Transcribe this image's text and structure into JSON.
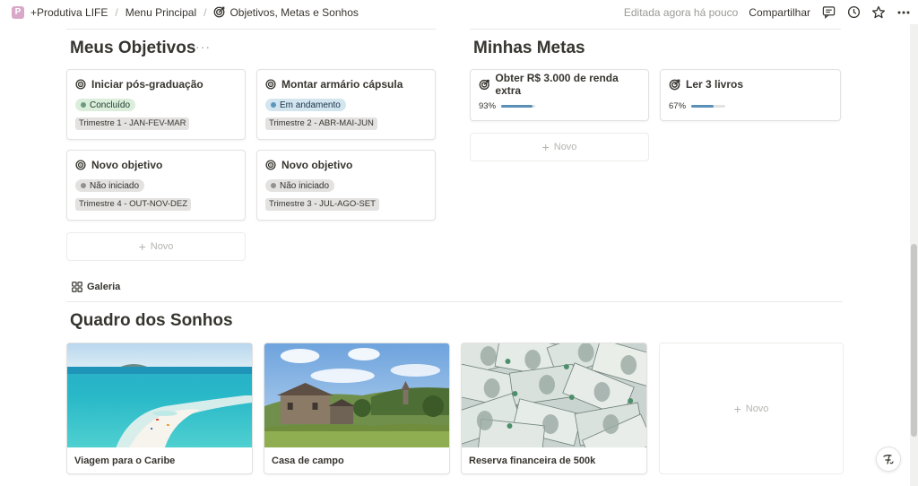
{
  "breadcrumb": {
    "workspace": "+Produtiva LIFE",
    "parent": "Menu Principal",
    "current": "Objetivos, Metas e Sonhos"
  },
  "topbar": {
    "edited": "Editada agora há pouco",
    "share": "Compartilhar"
  },
  "objectives": {
    "title": "Meus Objetivos",
    "more": "···",
    "new_label": "Novo",
    "cards": [
      {
        "title": "Iniciar pós-graduação",
        "status": "Concluído",
        "status_color": "green",
        "quarter": "Trimestre 1 - JAN-FEV-MAR"
      },
      {
        "title": "Montar armário cápsula",
        "status": "Em andamento",
        "status_color": "blue",
        "quarter": "Trimestre 2 - ABR-MAI-JUN"
      },
      {
        "title": "Novo objetivo",
        "status": "Não iniciado",
        "status_color": "gray",
        "quarter": "Trimestre 4 - OUT-NOV-DEZ"
      },
      {
        "title": "Novo objetivo",
        "status": "Não iniciado",
        "status_color": "gray",
        "quarter": "Trimestre 3 - JUL-AGO-SET"
      }
    ]
  },
  "goals": {
    "title": "Minhas Metas",
    "new_label": "Novo",
    "cards": [
      {
        "title": "Obter R$ 3.000 de renda extra",
        "progress_label": "93%",
        "progress": 0.93
      },
      {
        "title": "Ler 3 livros",
        "progress_label": "67%",
        "progress": 0.67
      }
    ]
  },
  "gallery_tab": {
    "label": "Galeria",
    "icon": "grid-icon"
  },
  "dreams": {
    "title": "Quadro dos Sonhos",
    "new_label": "Novo",
    "cards": [
      {
        "title": "Viagem para o Caribe",
        "image": "caribbean-beach"
      },
      {
        "title": "Casa de campo",
        "image": "country-house"
      },
      {
        "title": "Reserva financeira de 500k",
        "image": "dollar-bills"
      }
    ]
  },
  "colors": {
    "text": "#37352f",
    "muted": "#9b9a97",
    "progress": "#5a8fb8",
    "status_green": "#dbeddb",
    "status_blue": "#d3e5ef",
    "status_gray": "#e3e2e0"
  }
}
